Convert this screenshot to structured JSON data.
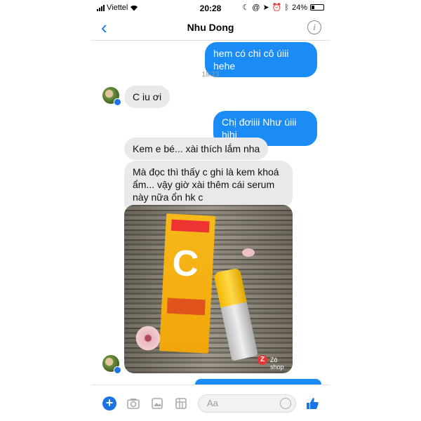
{
  "status_bar": {
    "carrier": "Viettel",
    "time": "20:28",
    "battery": "24%"
  },
  "header": {
    "back_icon": "chevron-left-icon",
    "title": "Nhu Dong",
    "info_icon": "info-icon"
  },
  "messages": [
    {
      "side": "out",
      "text": "hem có chi cô úiii hehe"
    },
    {
      "type": "timestamp",
      "text": "18:23"
    },
    {
      "side": "in",
      "text": "C iu ơi"
    },
    {
      "side": "out",
      "text": "Chị đơiiii Như úiii hihi"
    },
    {
      "side": "in",
      "text": "Kem e bé... xài thích lắm nha"
    },
    {
      "side": "in",
      "text": "Mà đọc thì thấy c ghi là kem khoá ẩm... vậy giờ xài thêm cái serum này nữa ổn hk c"
    },
    {
      "side": "in",
      "type": "photo",
      "watermark": "Zô shop"
    }
  ],
  "composer": {
    "placeholder": "Aa"
  },
  "colors": {
    "accent": "#1b74e4",
    "outgoing_bubble": "#1b8cf5",
    "incoming_bubble": "#e9e9eb"
  }
}
